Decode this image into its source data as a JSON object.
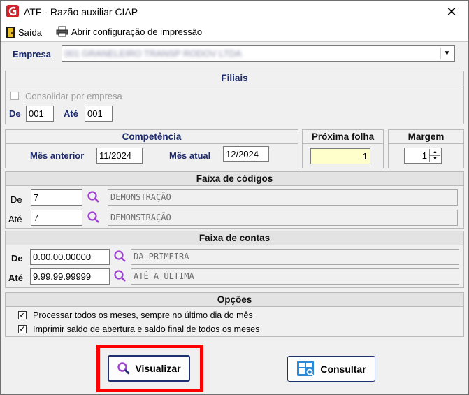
{
  "window": {
    "title": "ATF - Razão auxiliar CIAP",
    "close_glyph": "✕"
  },
  "toolbar": {
    "exit_label": "Saída",
    "print_config_label": "Abrir configuração de impressão"
  },
  "empresa": {
    "label": "Empresa",
    "value": "001 GRANELEIRO TRANSP RODOV LTDA"
  },
  "filiais": {
    "header": "Filiais",
    "consolidate_label": "Consolidar por empresa",
    "consolidate_checked": false,
    "from_label": "De",
    "from_value": "001",
    "to_label": "Até",
    "to_value": "001"
  },
  "competencia": {
    "header": "Competência",
    "prev_month_label": "Mês anterior",
    "prev_month_value": "11/2024",
    "cur_month_label": "Mês atual",
    "cur_month_value": "12/2024"
  },
  "proxima_folha": {
    "header": "Próxima folha",
    "value": "1"
  },
  "margem": {
    "header": "Margem",
    "value": "1"
  },
  "faixa_codigos": {
    "header": "Faixa de códigos",
    "from_label": "De",
    "from_value": "7",
    "from_desc": "DEMONSTRAÇÃO",
    "to_label": "Até",
    "to_value": "7",
    "to_desc": "DEMONSTRAÇÃO"
  },
  "faixa_contas": {
    "header": "Faixa de contas",
    "from_label": "De",
    "from_value": "0.00.00.00000",
    "from_desc": "DA PRIMEIRA",
    "to_label": "Até",
    "to_value": "9.99.99.99999",
    "to_desc": "ATÉ A ÚLTIMA"
  },
  "opcoes": {
    "header": "Opções",
    "opt1_label": "Processar todos os meses, sempre no último dia do mês",
    "opt1_checked": true,
    "opt2_label": "Imprimir saldo de abertura e saldo final de todos os meses",
    "opt2_checked": true
  },
  "buttons": {
    "visualizar_label": "Visualizar",
    "consultar_label": "Consultar"
  },
  "colors": {
    "accent": "#1b2a6b",
    "highlight": "#ff0000",
    "search_icon": "#a040d0",
    "app_icon": "#d0202a"
  }
}
